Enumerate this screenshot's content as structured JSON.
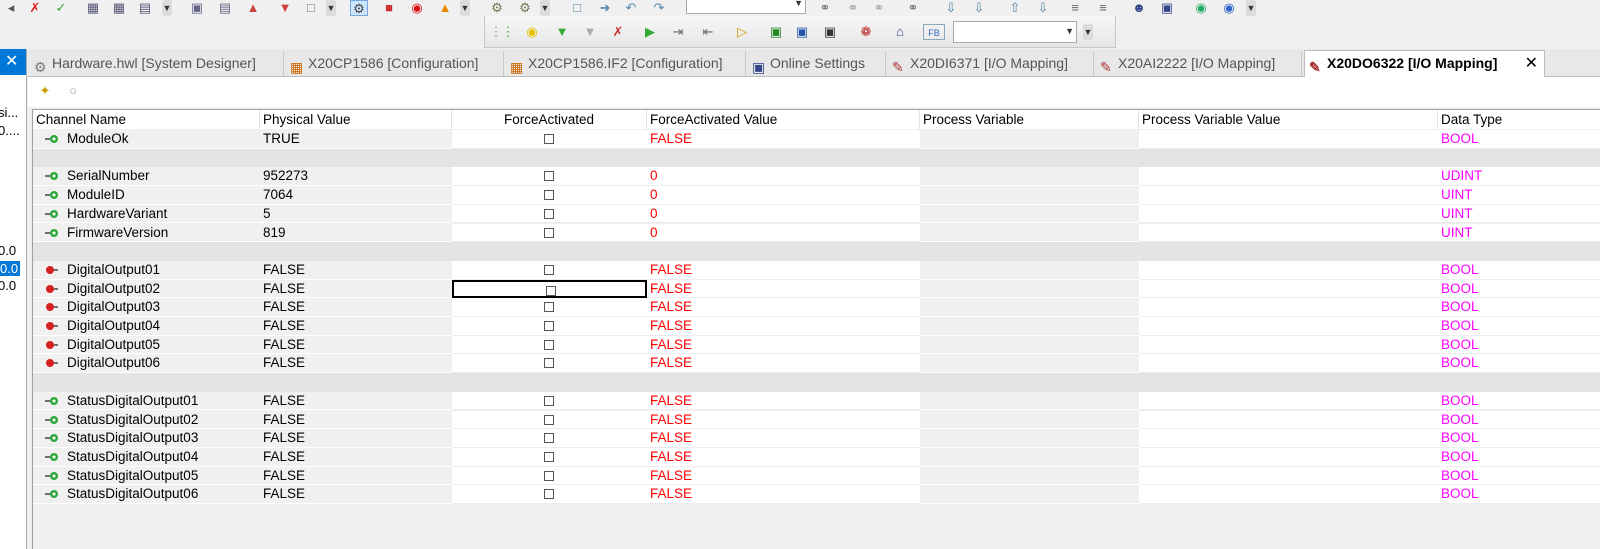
{
  "colors": {
    "force_value": "#ff0000",
    "data_type": "#ff00ff",
    "input_pin": "#2fa83a",
    "output_pin": "#d42020",
    "selection": "#0078d7"
  },
  "left_panel": {
    "lines": [
      "si...",
      "0....",
      "0.0",
      "0.0",
      "0.0"
    ]
  },
  "tabs": [
    {
      "label": "Hardware.hwl [System Designer]",
      "icon": "hardware-icon"
    },
    {
      "label": "X20CP1586 [Configuration]",
      "icon": "configuration-icon"
    },
    {
      "label": "X20CP1586.IF2 [Configuration]",
      "icon": "configuration-icon"
    },
    {
      "label": "Online Settings",
      "icon": "online-settings-icon"
    },
    {
      "label": "X20DI6371 [I/O Mapping]",
      "icon": "io-mapping-icon"
    },
    {
      "label": "X20AI2222 [I/O Mapping]",
      "icon": "io-mapping-icon"
    },
    {
      "label": "X20DO6322 [I/O Mapping]",
      "icon": "io-mapping-icon",
      "active": true
    }
  ],
  "toolbar2": {
    "fb_label": "FB"
  },
  "grid": {
    "columns": [
      "Channel Name",
      "Physical Value",
      "ForceActivated",
      "ForceActivated Value",
      "Process Variable",
      "Process Variable Value",
      "Data Type"
    ],
    "rows": [
      {
        "name": "ModuleOk",
        "physical": "TRUE",
        "force_value": "FALSE",
        "type": "BOOL",
        "dir": "in"
      },
      {
        "gap": true
      },
      {
        "name": "SerialNumber",
        "physical": "952273",
        "force_value": "0",
        "type": "UDINT",
        "dir": "in"
      },
      {
        "name": "ModuleID",
        "physical": "7064",
        "force_value": "0",
        "type": "UINT",
        "dir": "in"
      },
      {
        "name": "HardwareVariant",
        "physical": "5",
        "force_value": "0",
        "type": "UINT",
        "dir": "in"
      },
      {
        "name": "FirmwareVersion",
        "physical": "819",
        "force_value": "0",
        "type": "UINT",
        "dir": "in"
      },
      {
        "gap": true
      },
      {
        "name": "DigitalOutput01",
        "physical": "FALSE",
        "force_value": "FALSE",
        "type": "BOOL",
        "dir": "out"
      },
      {
        "name": "DigitalOutput02",
        "physical": "FALSE",
        "force_value": "FALSE",
        "type": "BOOL",
        "dir": "out",
        "focused": true
      },
      {
        "name": "DigitalOutput03",
        "physical": "FALSE",
        "force_value": "FALSE",
        "type": "BOOL",
        "dir": "out"
      },
      {
        "name": "DigitalOutput04",
        "physical": "FALSE",
        "force_value": "FALSE",
        "type": "BOOL",
        "dir": "out"
      },
      {
        "name": "DigitalOutput05",
        "physical": "FALSE",
        "force_value": "FALSE",
        "type": "BOOL",
        "dir": "out"
      },
      {
        "name": "DigitalOutput06",
        "physical": "FALSE",
        "force_value": "FALSE",
        "type": "BOOL",
        "dir": "out"
      },
      {
        "gap": true
      },
      {
        "name": "StatusDigitalOutput01",
        "physical": "FALSE",
        "force_value": "FALSE",
        "type": "BOOL",
        "dir": "in"
      },
      {
        "name": "StatusDigitalOutput02",
        "physical": "FALSE",
        "force_value": "FALSE",
        "type": "BOOL",
        "dir": "in"
      },
      {
        "name": "StatusDigitalOutput03",
        "physical": "FALSE",
        "force_value": "FALSE",
        "type": "BOOL",
        "dir": "in"
      },
      {
        "name": "StatusDigitalOutput04",
        "physical": "FALSE",
        "force_value": "FALSE",
        "type": "BOOL",
        "dir": "in"
      },
      {
        "name": "StatusDigitalOutput05",
        "physical": "FALSE",
        "force_value": "FALSE",
        "type": "BOOL",
        "dir": "in"
      },
      {
        "name": "StatusDigitalOutput06",
        "physical": "FALSE",
        "force_value": "FALSE",
        "type": "BOOL",
        "dir": "in"
      }
    ]
  }
}
